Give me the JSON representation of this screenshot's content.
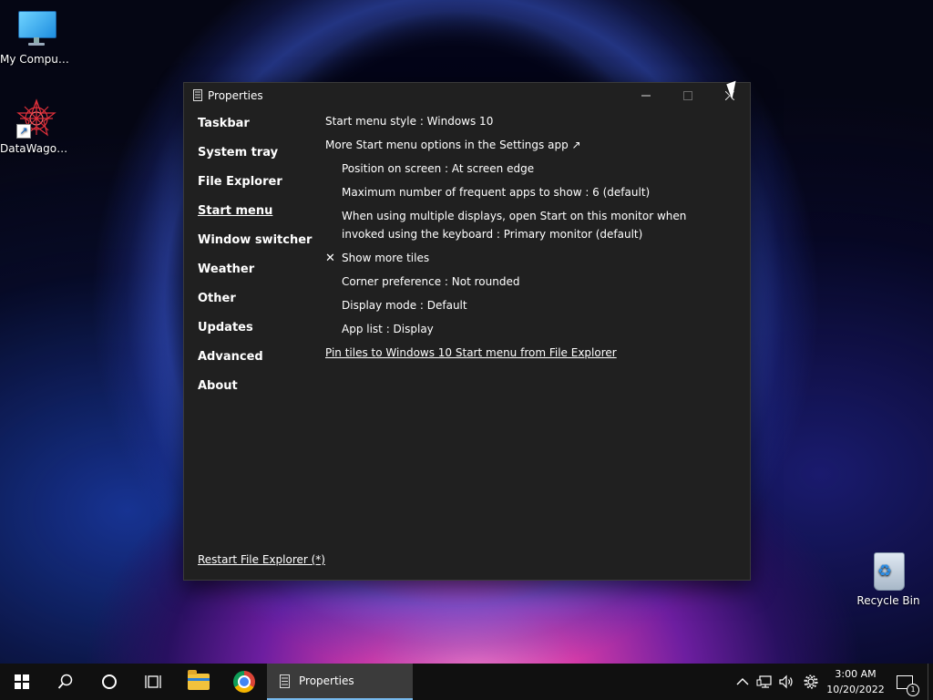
{
  "desktop": {
    "icons": [
      {
        "label": "My Computer"
      },
      {
        "label": "DataWagon..."
      },
      {
        "label": "Recycle Bin"
      }
    ]
  },
  "window": {
    "title": "Properties",
    "nav": [
      {
        "label": "Taskbar"
      },
      {
        "label": "System tray"
      },
      {
        "label": "File Explorer"
      },
      {
        "label": "Start menu"
      },
      {
        "label": "Window switcher"
      },
      {
        "label": "Weather"
      },
      {
        "label": "Other"
      },
      {
        "label": "Updates"
      },
      {
        "label": "Advanced"
      },
      {
        "label": "About"
      }
    ],
    "active_nav": "Start menu",
    "settings": {
      "start_menu_style": "Start menu style : Windows 10",
      "more_options": "More Start menu options in the Settings app ↗",
      "position": "Position on screen : At screen edge",
      "max_frequent": "Maximum number of frequent apps to show : 6 (default)",
      "multi_display": "When using multiple displays, open Start on this monitor when invoked using the keyboard : Primary monitor (default)",
      "check_symbol": "✕",
      "show_more_tiles": "Show more tiles",
      "corner_pref": "Corner preference : Not rounded",
      "display_mode": "Display mode : Default",
      "app_list": "App list : Display",
      "pin_tiles": "Pin tiles to Windows 10 Start menu from File Explorer"
    },
    "restart_link": "Restart File Explorer (*)"
  },
  "taskbar": {
    "active_app_label": "Properties",
    "clock_time": "3:00 AM",
    "clock_date": "10/20/2022",
    "notification_count": "1"
  }
}
